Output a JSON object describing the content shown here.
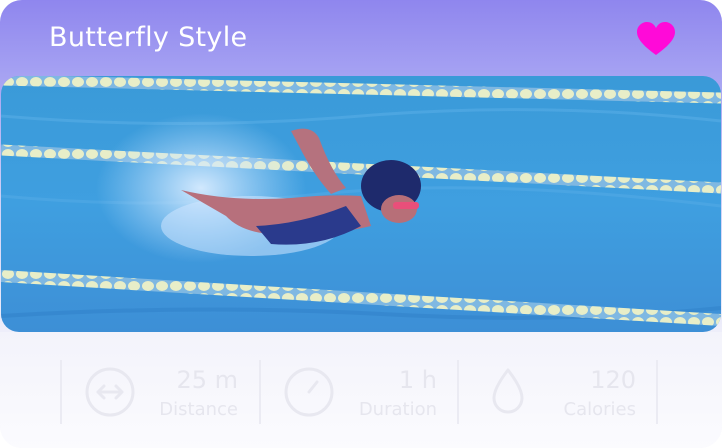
{
  "header": {
    "title": "Butterfly Style",
    "favorite_icon": "heart-icon",
    "favorite_color": "#ff0ad8"
  },
  "image": {
    "alt": "Swimmer doing butterfly stroke in pool",
    "tint": "#5a66e8"
  },
  "stats": [
    {
      "icon": "arrows-horizontal-icon",
      "value": "25 m",
      "label": "Distance"
    },
    {
      "icon": "stopwatch-icon",
      "value": "1 h",
      "label": "Duration"
    },
    {
      "icon": "drop-icon",
      "value": "120",
      "label": "Calories"
    }
  ]
}
